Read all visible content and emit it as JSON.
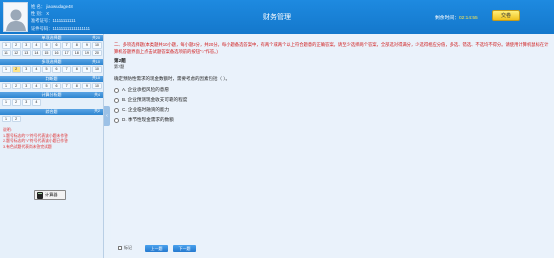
{
  "app": {
    "title": "财务管理"
  },
  "user": {
    "name_line": "姓 名： jiaowudage48",
    "gender_line": "性 别： X",
    "exam_id_line": "准考证号：11111111111",
    "cert_line": "证件号码：111111111111111111"
  },
  "timer": {
    "label": "剩余时间：",
    "value": "02:14:55"
  },
  "submit": {
    "label": "交卷"
  },
  "sidebar": {
    "sections": [
      {
        "title": "单项选择题",
        "count": "共20",
        "cells": [
          "1",
          "2",
          "3",
          "4",
          "5",
          "6",
          "7",
          "8",
          "9",
          "10",
          "11",
          "12",
          "13",
          "14",
          "15",
          "16",
          "17",
          "18",
          "19",
          "20"
        ]
      },
      {
        "title": "多项选择题",
        "count": "共10",
        "cells": [
          "1",
          "2",
          "3",
          "4",
          "5",
          "6",
          "7",
          "8",
          "9",
          "10"
        ]
      },
      {
        "title": "判断题",
        "count": "共10",
        "cells": [
          "1",
          "2",
          "3",
          "4",
          "5",
          "6",
          "7",
          "8",
          "9",
          "10"
        ]
      },
      {
        "title": "计算分析题",
        "count": "共4",
        "cells": [
          "1",
          "2",
          "3",
          "4"
        ]
      },
      {
        "title": "综合题",
        "count": "共2",
        "cells": [
          "1",
          "2"
        ]
      }
    ],
    "notes": {
      "title": "说明:",
      "line1": "1.题号标志的\"?\"符号代表该小题未作答",
      "line2": "2.题号标志的\"√\"符号代表该小题已作答",
      "line3": "3.有色试题代表尚未答完试题"
    },
    "calc_label": "计算器"
  },
  "question": {
    "instruction_head": "二、多项选择题",
    "instruction_body": "(本类题共10小题，每小题2分，共20分。每小题备选答案中，有两个或两个以上符合题意的正确答案。请至少选择两个答案，全部选对得满分，少选得相应分值，多选、错选、不选均不得分。请使用计算机鼠标在计算机答题界面上点击试题答案备选项前的按钮\"○\"作答。)",
    "number": "第2题",
    "score": "第7题",
    "stem": "确定预防性需求的现金数额时，需要考虑的因素包括（ ）。",
    "options": [
      "A. 企业承担风险的意愿",
      "B. 企业预测现金收支可靠的程度",
      "C. 企业临时融资的能力",
      "D. 季节性现金需求的数额"
    ],
    "mark_label": "标记",
    "prev_label": "上一题",
    "next_label": "下一题"
  }
}
